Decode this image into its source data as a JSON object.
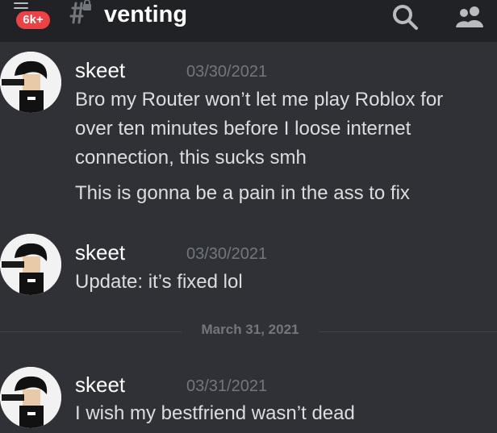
{
  "header": {
    "badge": "6k+",
    "channel": "venting"
  },
  "messages": [
    {
      "username": "skeet",
      "timestamp": "03/30/2021",
      "lines": [
        "Bro my Router won’t let me play Roblox for",
        "over ten minutes before I loose internet",
        "connection, this sucks smh",
        "This is gonna be a pain in the ass to fix"
      ]
    },
    {
      "username": "skeet",
      "timestamp": "03/30/2021",
      "lines": [
        "Update: it’s fixed lol"
      ]
    },
    {
      "username": "skeet",
      "timestamp": "03/31/2021",
      "lines": [
        "I wish my bestfriend  wasn’t dead"
      ]
    }
  ],
  "date_divider": "March 31, 2021",
  "colors": {
    "background": "#2f3136",
    "header": "#202225",
    "badge": "#ed4245",
    "timestamp": "#72767d"
  }
}
